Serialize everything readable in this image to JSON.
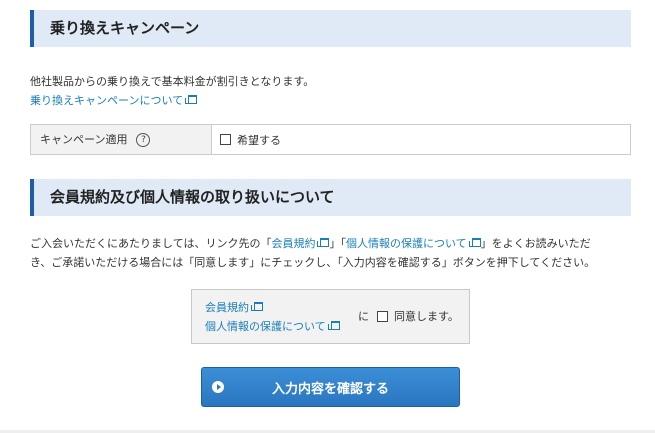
{
  "campaign_section": {
    "title": "乗り換えキャンペーン",
    "description": "他社製品からの乗り換えで基本料金が割引きとなります。",
    "link_label": "乗り換えキャンペーンについて",
    "table": {
      "header": "キャンペーン適用",
      "help_glyph": "?",
      "checkbox_label": "希望する"
    }
  },
  "terms_section": {
    "title": "会員規約及び個人情報の取り扱いについて",
    "paragraph": {
      "prefix": "ご入会いただくにあたりましては、リンク先の「",
      "link1": "会員規約",
      "middle": "」「",
      "link2": "個人情報の保護について",
      "suffix": "」をよくお読みいただ",
      "line2": "き、ご承諾いただける場合には「同意します」にチェックし、「入力内容を確認する」ボタンを押下してください。"
    },
    "agree_box": {
      "link1": "会員規約",
      "link2": "個人情報の保護について",
      "particle": "に",
      "checkbox_label": "同意します。"
    }
  },
  "confirm_button_label": "入力内容を確認する",
  "colors": {
    "section_bar": "#dfeaf6",
    "section_accent": "#1e5ea8",
    "link": "#1a7fb8",
    "button": "#2a76c0"
  }
}
